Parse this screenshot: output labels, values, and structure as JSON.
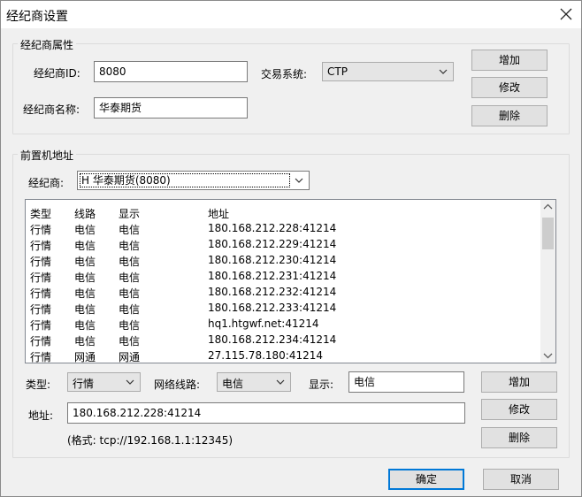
{
  "window": {
    "title": "经纪商设置"
  },
  "broker_group": {
    "title": "经纪商属性",
    "id_label": "经纪商ID:",
    "id_value": "8080",
    "name_label": "经纪商名称:",
    "name_value": "华泰期货",
    "trade_system_label": "交易系统:",
    "trade_system_value": "CTP",
    "add_label": "增加",
    "edit_label": "修改",
    "delete_label": "删除"
  },
  "front_group": {
    "title": "前置机地址",
    "broker_label": "经纪商:",
    "broker_value": "H 华泰期货(8080)",
    "columns": [
      "类型",
      "线路",
      "显示",
      "地址"
    ],
    "rows": [
      [
        "行情",
        "电信",
        "电信",
        "180.168.212.228:41214"
      ],
      [
        "行情",
        "电信",
        "电信",
        "180.168.212.229:41214"
      ],
      [
        "行情",
        "电信",
        "电信",
        "180.168.212.230:41214"
      ],
      [
        "行情",
        "电信",
        "电信",
        "180.168.212.231:41214"
      ],
      [
        "行情",
        "电信",
        "电信",
        "180.168.212.232:41214"
      ],
      [
        "行情",
        "电信",
        "电信",
        "180.168.212.233:41214"
      ],
      [
        "行情",
        "电信",
        "电信",
        "hq1.htgwf.net:41214"
      ],
      [
        "行情",
        "电信",
        "电信",
        "180.168.212.234:41214"
      ],
      [
        "行情",
        "网通",
        "网通",
        "27.115.78.180:41214"
      ]
    ],
    "type_label": "类型:",
    "type_value": "行情",
    "line_label": "网络线路:",
    "line_value": "电信",
    "display_label": "显示:",
    "display_value": "电信",
    "address_label": "地址:",
    "address_value": "180.168.212.228:41214",
    "format_hint": "(格式: tcp://192.168.1.1:12345)",
    "add_label": "增加",
    "edit_label": "修改",
    "delete_label": "删除"
  },
  "footer": {
    "ok_label": "确定",
    "cancel_label": "取消"
  },
  "colors": {
    "accent": "#0078d7",
    "background": "#f0f0f0"
  }
}
